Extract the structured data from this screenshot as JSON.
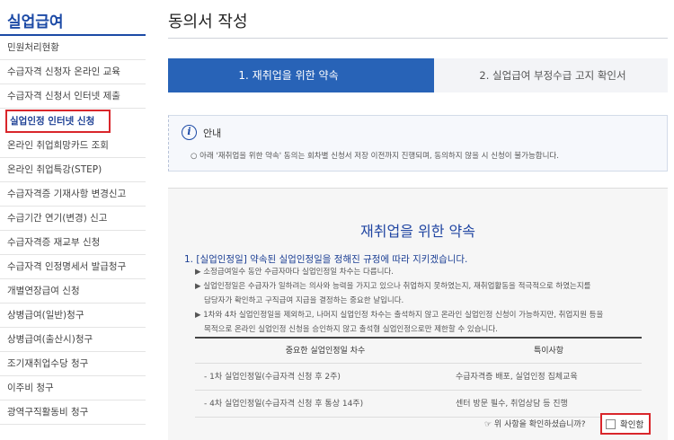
{
  "sidebar": {
    "title": "실업급여",
    "items": [
      {
        "label": "민원처리현황"
      },
      {
        "label": "수급자격 신청자 온라인 교육"
      },
      {
        "label": "수급자격 신청서 인터넷 제출"
      },
      {
        "label": "실업인정 인터넷 신청",
        "active": true
      },
      {
        "label": "온라인 취업희망카드 조회"
      },
      {
        "label": "온라인 취업특강(STEP)"
      },
      {
        "label": "수급자격증 기재사항 변경신고"
      },
      {
        "label": "수급기간 연기(변경) 신고"
      },
      {
        "label": "수급자격증 재교부 신청"
      },
      {
        "label": "수급자격 인정명세서 발급청구"
      },
      {
        "label": "개별연장급여 신청"
      },
      {
        "label": "상병급여(일반)청구"
      },
      {
        "label": "상병급여(출산시)청구"
      },
      {
        "label": "조기재취업수당 청구"
      },
      {
        "label": "이주비 청구"
      },
      {
        "label": "광역구직활동비 청구"
      }
    ]
  },
  "main": {
    "title": "동의서 작성",
    "steps": [
      {
        "label": "1. 재취업을 위한 약속",
        "active": true
      },
      {
        "label": "2. 실업급여 부정수급 고지 확인서",
        "active": false
      }
    ],
    "notice": {
      "icon": "info-icon",
      "title": "안내",
      "text": "○ 아래 '재취업을 위한 약속' 동의는 회차별 신청서 저장 이전까지 진행되며, 동의하지 않을 시 신청이 불가능합니다."
    },
    "promise": {
      "title": "재취업을 위한 약속",
      "section_head": "1. [실업인정일] 약속된 실업인정일을 정해진 규정에 따라 지키겠습니다.",
      "bullet1": "▶ 소정급여일수 동안 수급자마다 실업인정일 차수는 다릅니다.",
      "bullet2a": "▶ 실업인정일은 수급자가 일하려는 의사와 능력을 가지고 있으나 취업하지 못하였는지, 재취업활동을 적극적으로 하였는지를",
      "bullet2b": "담당자가 확인하고 구직급여 지급을 결정하는 중요한 날입니다.",
      "bullet3a": "▶ 1차와 4차 실업인정일을 제외하고, 나머지 실업인정 차수는 출석하지 않고 온라인 실업인정 신청이 가능하지만, 취업지원 등을",
      "bullet3b": "목적으로 온라인 실업인정 신청을 승인하지 않고 출석형 실업인정으로만 제한할 수 있습니다.",
      "table": {
        "headers": [
          "중요한 실업인정일 차수",
          "특이사항"
        ],
        "rows": [
          [
            "- 1차 실업인정일(수급자격 신청 후 2주)",
            "수급자격증 배포, 실업인정 집체교육"
          ],
          [
            "- 4차 실업인정일(수급자격 신청 후 통상 14주)",
            "센터 방문 필수, 취업상담 등 진행"
          ]
        ]
      },
      "confirm_question": "☞ 위 사항을 확인하셨습니까?",
      "confirm_label": "확인함"
    }
  },
  "colors": {
    "brand_blue": "#1c4aa6",
    "step_active_bg": "#2863b7",
    "highlight_red": "#d9262b"
  }
}
